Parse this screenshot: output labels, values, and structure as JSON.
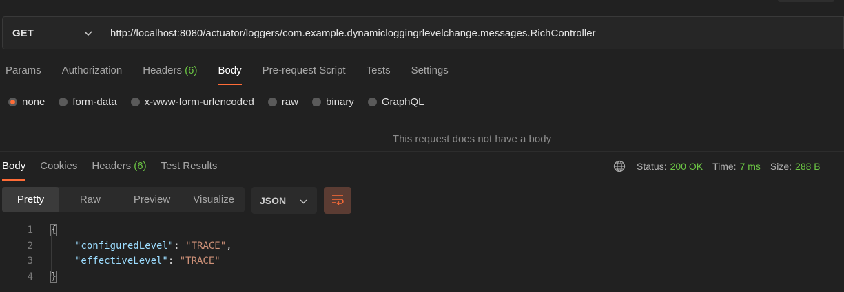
{
  "request": {
    "method": "GET",
    "url": "http://localhost:8080/actuator/loggers/com.example.dynamicloggingrlevelchange.messages.RichController"
  },
  "request_tabs": [
    {
      "label": "Params"
    },
    {
      "label": "Authorization"
    },
    {
      "label": "Headers",
      "count": "(6)"
    },
    {
      "label": "Body"
    },
    {
      "label": "Pre-request Script"
    },
    {
      "label": "Tests"
    },
    {
      "label": "Settings"
    }
  ],
  "active_request_tab": "Body",
  "body_types": [
    "none",
    "form-data",
    "x-www-form-urlencoded",
    "raw",
    "binary",
    "GraphQL"
  ],
  "selected_body_type": "none",
  "no_body_message": "This request does not have a body",
  "response_tabs": [
    {
      "label": "Body"
    },
    {
      "label": "Cookies"
    },
    {
      "label": "Headers",
      "count": "(6)"
    },
    {
      "label": "Test Results"
    }
  ],
  "response_status": {
    "status_label": "Status:",
    "status_value": "200 OK",
    "time_label": "Time:",
    "time_value": "7 ms",
    "size_label": "Size:",
    "size_value": "288 B"
  },
  "view_modes": [
    "Pretty",
    "Raw",
    "Preview",
    "Visualize"
  ],
  "active_view_mode": "Pretty",
  "format": "JSON",
  "code": {
    "line_numbers": [
      "1",
      "2",
      "3",
      "4"
    ],
    "open_brace": "{",
    "close_brace": "}",
    "entries": [
      {
        "key": "\"configuredLevel\"",
        "colon": ": ",
        "value": "\"TRACE\"",
        "comma": ","
      },
      {
        "key": "\"effectiveLevel\"",
        "colon": ": ",
        "value": "\"TRACE\"",
        "comma": ""
      }
    ]
  },
  "colors": {
    "accent": "#ff6c37",
    "success": "#6cc644",
    "background": "#212121",
    "json_key": "#9cdcfe",
    "json_string": "#ce9178"
  }
}
